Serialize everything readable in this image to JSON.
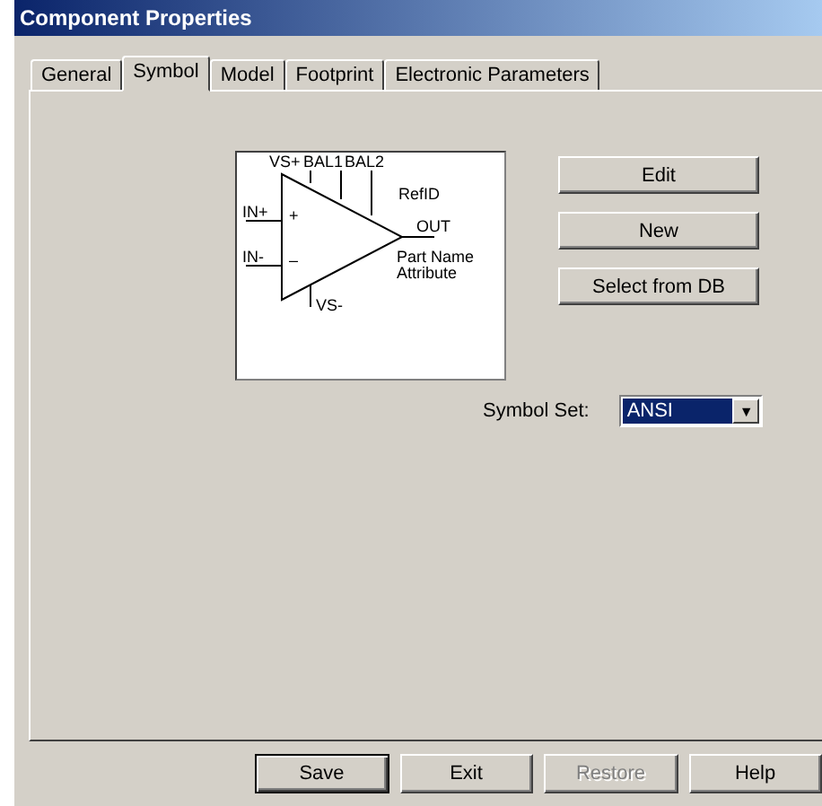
{
  "window": {
    "title": "Component Properties"
  },
  "tabs": [
    {
      "label": "General",
      "selected": false
    },
    {
      "label": "Symbol",
      "selected": true
    },
    {
      "label": "Model",
      "selected": false
    },
    {
      "label": "Footprint",
      "selected": false
    },
    {
      "label": "Electronic Parameters",
      "selected": false
    }
  ],
  "symbol_preview": {
    "pins": [
      {
        "label": "VS+",
        "kind": "top"
      },
      {
        "label": "BAL1",
        "kind": "top"
      },
      {
        "label": "BAL2",
        "kind": "top"
      },
      {
        "label": "IN+",
        "kind": "left"
      },
      {
        "label": "IN-",
        "kind": "left"
      },
      {
        "label": "OUT",
        "kind": "right"
      },
      {
        "label": "VS-",
        "kind": "bottom"
      }
    ],
    "plus_sign": "+",
    "minus_sign": "–",
    "ref_id": "RefID",
    "part_name": "Part Name",
    "attribute": "Attribute"
  },
  "symbol_buttons": [
    "Edit",
    "New",
    "Select from DB"
  ],
  "symbol_set": {
    "label": "Symbol Set:",
    "value": "ANSI",
    "arrow": "▼"
  },
  "footer_buttons": [
    {
      "label": "Save",
      "default": true,
      "disabled": false
    },
    {
      "label": "Exit",
      "default": false,
      "disabled": false
    },
    {
      "label": "Restore",
      "default": false,
      "disabled": true
    },
    {
      "label": "Help",
      "default": false,
      "disabled": false
    }
  ]
}
